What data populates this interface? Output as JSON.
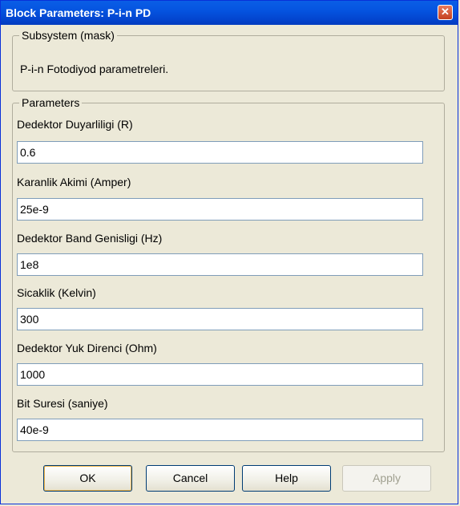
{
  "window": {
    "title": "Block Parameters: P-i-n PD"
  },
  "subsystem": {
    "legend": "Subsystem (mask)",
    "description": "P-i-n Fotodiyod parametreleri."
  },
  "parameters": {
    "legend": "Parameters",
    "fields": [
      {
        "label": "Dedektor Duyarliligi (R)",
        "value": "0.6"
      },
      {
        "label": "Karanlik Akimi (Amper)",
        "value": "25e-9"
      },
      {
        "label": "Dedektor Band Genisligi (Hz)",
        "value": "1e8"
      },
      {
        "label": "Sicaklik (Kelvin)",
        "value": "300"
      },
      {
        "label": "Dedektor Yuk Direnci (Ohm)",
        "value": "1000"
      },
      {
        "label": "Bit Suresi (saniye)",
        "value": "40e-9"
      }
    ]
  },
  "buttons": {
    "ok": "OK",
    "cancel": "Cancel",
    "help": "Help",
    "apply": "Apply"
  },
  "icons": {
    "close": "close-icon"
  }
}
